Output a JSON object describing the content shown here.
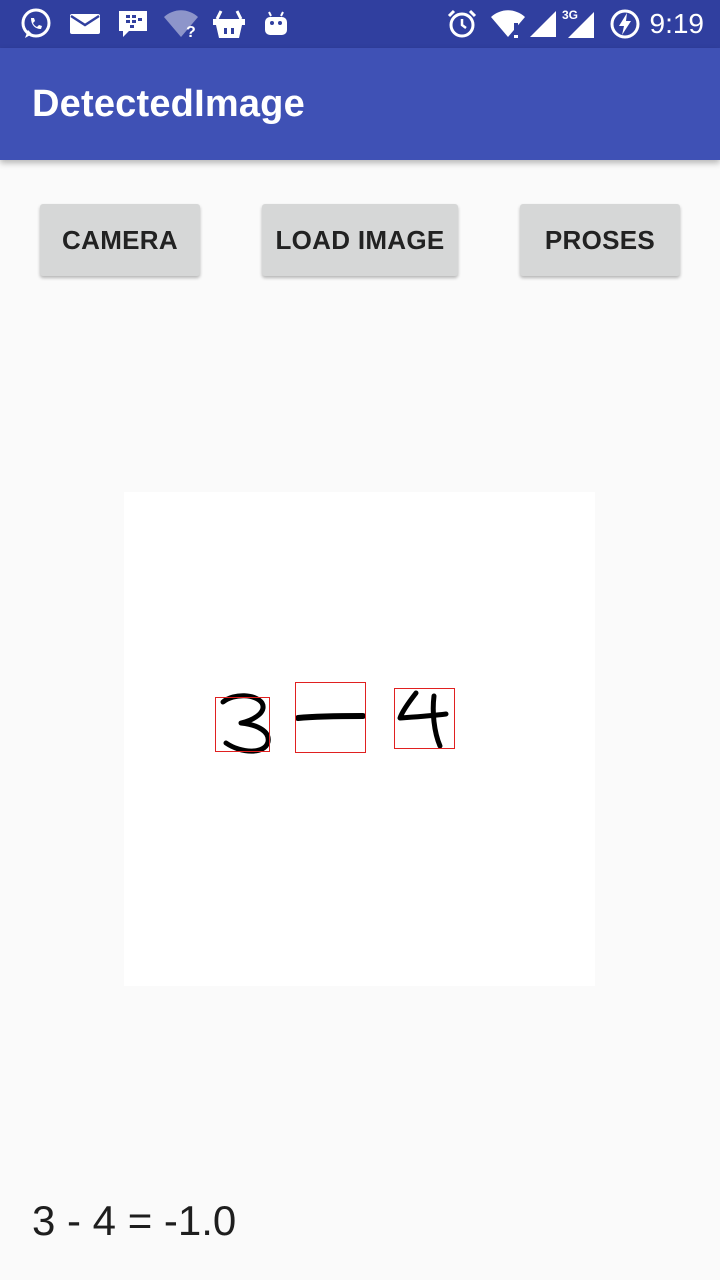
{
  "status_bar": {
    "time": "9:19",
    "network_label": "3G",
    "left_icons": [
      "whatsapp-icon",
      "email-icon",
      "bbm-icon",
      "wifi-question-icon",
      "basket-icon",
      "android-icon"
    ],
    "right_icons": [
      "alarm-icon",
      "wifi-icon",
      "signal-icon",
      "signal-3g-icon",
      "battery-charging-icon"
    ]
  },
  "app_bar": {
    "title": "DetectedImage"
  },
  "buttons": {
    "camera": "CAMERA",
    "load_image": "LOAD IMAGE",
    "proses": "PROSES"
  },
  "detected_image": {
    "boxes": [
      "3",
      "-",
      "4"
    ],
    "box_color": "#e02020"
  },
  "result_text": "3 - 4 = -1.0",
  "colors": {
    "status_bar": "#303f9f",
    "app_bar": "#3f51b5",
    "button": "#d6d7d7",
    "background": "#fafafa"
  }
}
